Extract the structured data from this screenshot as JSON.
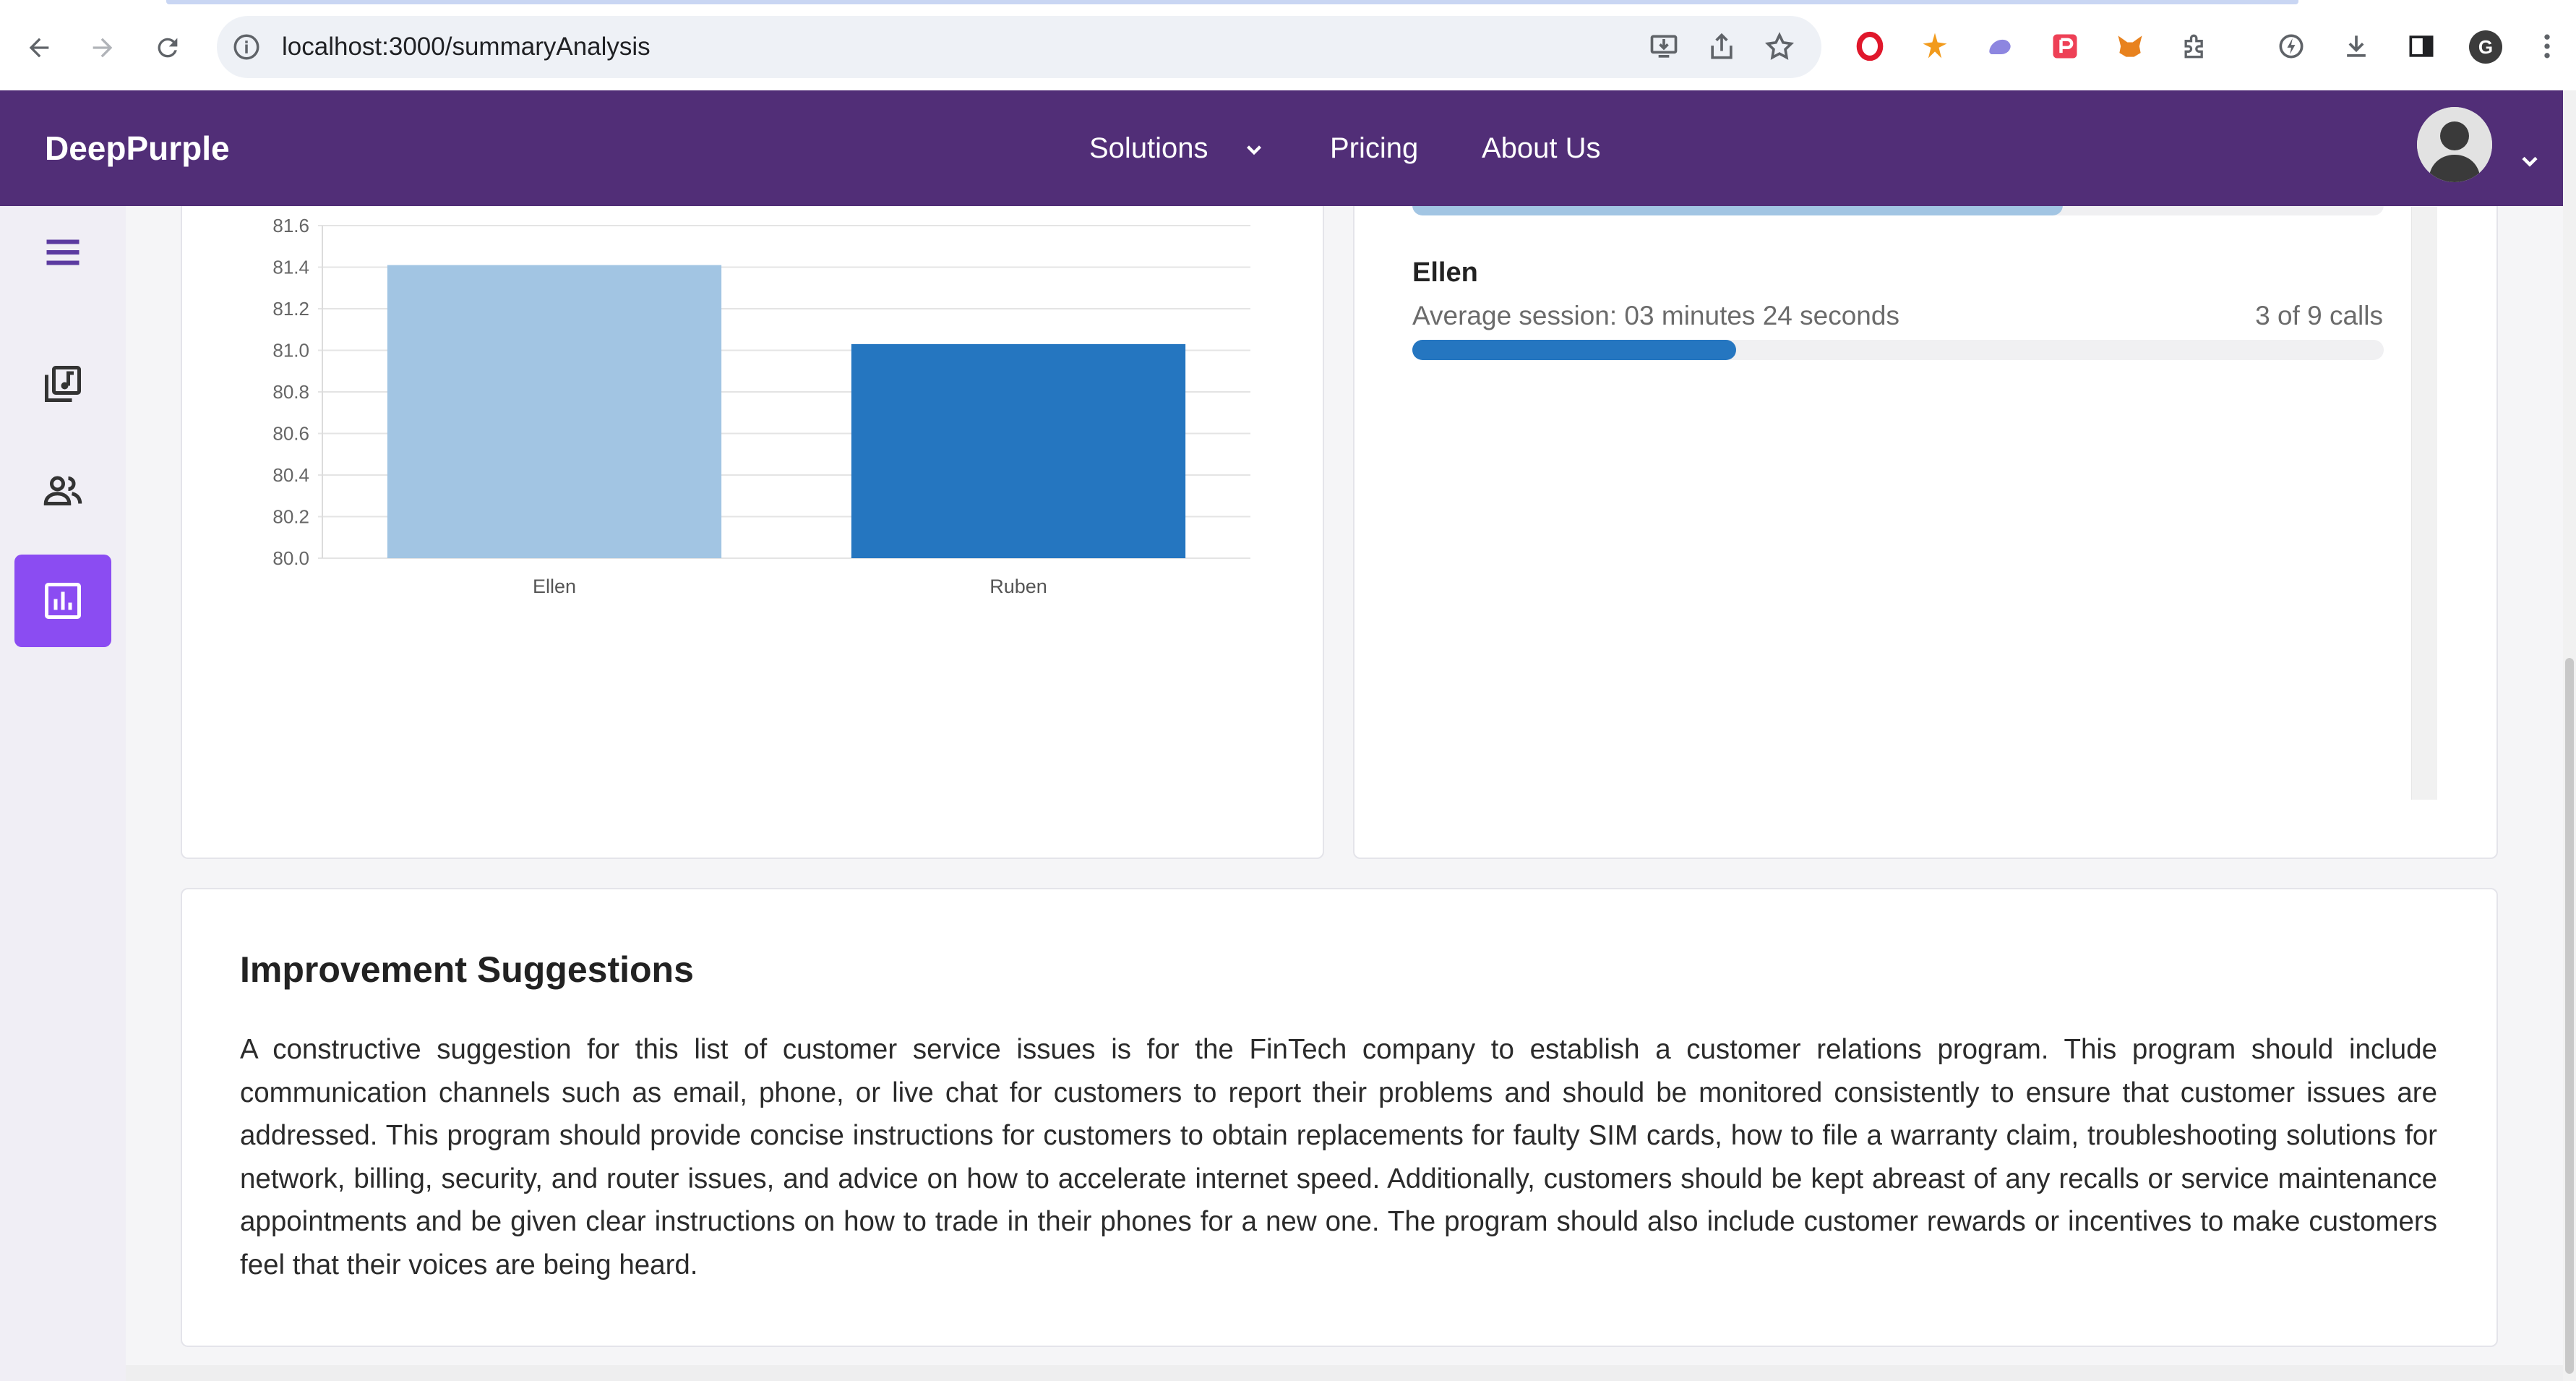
{
  "browser": {
    "url": "localhost:3000/summaryAnalysis",
    "profile_initial": "G"
  },
  "header": {
    "brand": "DeepPurple",
    "nav": [
      {
        "label": "Solutions"
      },
      {
        "label": "Pricing"
      },
      {
        "label": "About Us"
      }
    ]
  },
  "sidebar": {
    "items": [
      {
        "name": "menu",
        "icon": "hamburger-icon"
      },
      {
        "name": "analysis",
        "icon": "music-library-icon"
      },
      {
        "name": "agents",
        "icon": "people-icon"
      },
      {
        "name": "summary",
        "icon": "bar-chart-icon",
        "active": true
      }
    ]
  },
  "chart_data": {
    "type": "bar",
    "categories": [
      "Ellen",
      "Ruben"
    ],
    "values": [
      81.41,
      81.03
    ],
    "colors": [
      "#a2c5e3",
      "#2576c0"
    ],
    "ylim": [
      80.0,
      81.6
    ],
    "yticks": [
      "80.0",
      "80.2",
      "80.4",
      "80.6",
      "80.8",
      "81.0",
      "81.2",
      "81.4",
      "81.6"
    ],
    "grid": true,
    "title": "",
    "xlabel": "",
    "ylabel": ""
  },
  "agents": {
    "items": [
      {
        "name": "Ellen",
        "session": "Average session: 03 minutes 24 seconds",
        "count": "3 of 9 calls",
        "progress": 0.333,
        "color": "#2576c0"
      }
    ],
    "partial_progress": 0.67,
    "partial_color": "#a2c5e3"
  },
  "suggestions": {
    "title": "Improvement Suggestions",
    "text": "A constructive suggestion for this list of customer service issues is for the FinTech company to establish a customer relations program. This program should include communication channels such as email, phone, or live chat for customers to report their problems and should be monitored consistently to ensure that customer issues are addressed. This program should provide concise instructions for customers to obtain replacements for faulty SIM cards, how to file a warranty claim, troubleshooting solutions for network, billing, security, and router issues, and advice on how to accelerate internet speed. Additionally, customers should be kept abreast of any recalls or service maintenance appointments and be given clear instructions on how to trade in their phones for a new one. The program should also include customer rewards or incentives to make customers feel that their voices are being heard."
  }
}
